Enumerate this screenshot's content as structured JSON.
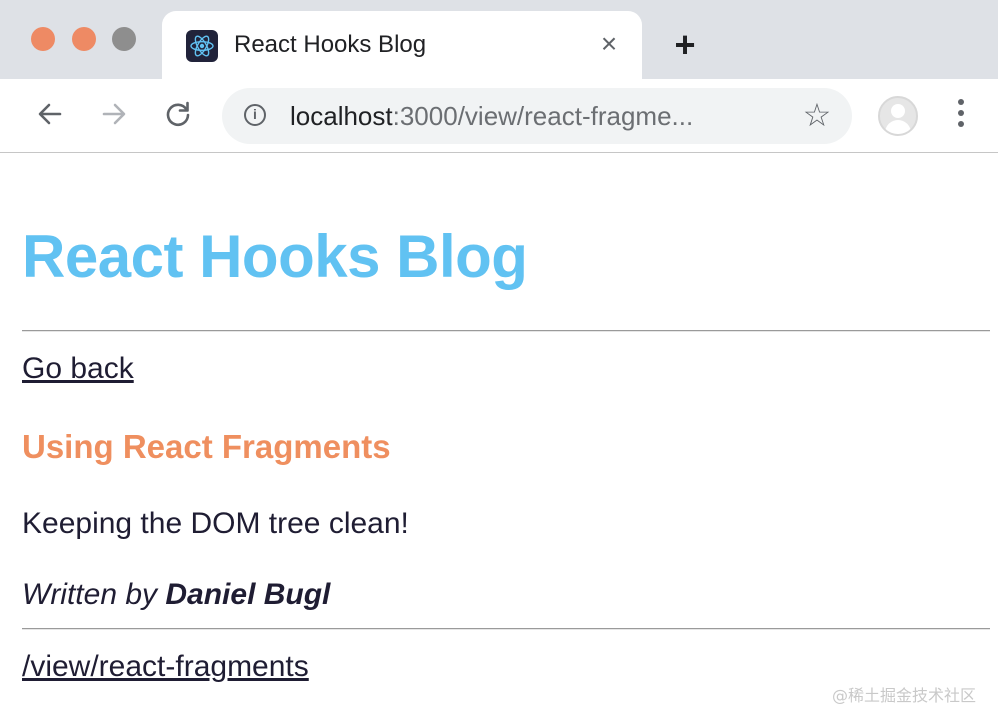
{
  "browser": {
    "tab_title": "React Hooks Blog",
    "tab_close": "×",
    "new_tab": "+",
    "url_host": "localhost",
    "url_rest": ":3000/view/react-fragme...",
    "icons": {
      "back": "arrow-left-icon",
      "forward": "arrow-right-icon",
      "reload": "reload-icon",
      "info": "info-icon",
      "bookmark": "star-icon",
      "profile": "avatar-icon",
      "menu": "kebab-menu-icon",
      "favicon": "react-logo-icon"
    },
    "traffic_light_colors": [
      "#ee8a64",
      "#ee8a64",
      "#8e8e8e"
    ]
  },
  "page": {
    "title": "React Hooks Blog",
    "go_back": "Go back",
    "post": {
      "title": "Using React Fragments",
      "body": "Keeping the DOM tree clean!",
      "byline_prefix": "Written by ",
      "author": "Daniel Bugl"
    },
    "footer_link": "/view/react-fragments"
  },
  "watermark": "@稀土掘金技术社区",
  "colors": {
    "title": "#61c2f2",
    "post_title": "#ef8f5f",
    "text": "#1f1d33"
  }
}
